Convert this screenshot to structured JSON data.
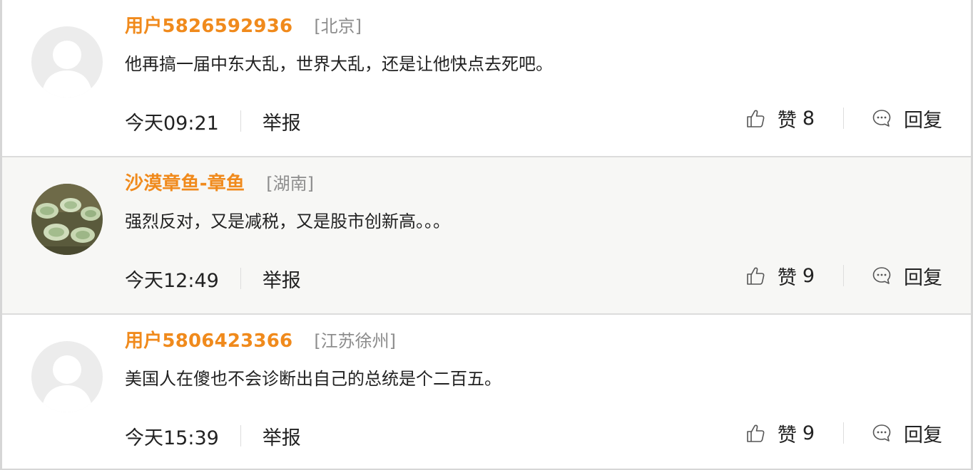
{
  "comments": [
    {
      "username": "用户5826592936",
      "location": "[北京]",
      "content": "他再搞一届中东大乱，世界大乱，还是让他快点去死吧。",
      "time": "今天09:21",
      "report_label": "举报",
      "like_label": "赞",
      "like_count": "8",
      "reply_label": "回复",
      "avatar": "default-avatar"
    },
    {
      "username": "沙漠章鱼-章鱼",
      "location": "[湖南]",
      "content": "强烈反对，又是减税，又是股市创新高。。。",
      "time": "今天12:49",
      "report_label": "举报",
      "like_label": "赞",
      "like_count": "9",
      "reply_label": "回复",
      "avatar": "photo-avatar"
    },
    {
      "username": "用户5806423366",
      "location": "[江苏徐州]",
      "content": "美国人在傻也不会诊断出自己的总统是个二百五。",
      "time": "今天15:39",
      "report_label": "举报",
      "like_label": "赞",
      "like_count": "9",
      "reply_label": "回复",
      "avatar": "default-avatar"
    }
  ],
  "colors": {
    "username": "#f08a1c",
    "location": "#8d8d8d",
    "text": "#222222",
    "alt_background": "#f7f7f5",
    "divider": "#dddddd"
  }
}
